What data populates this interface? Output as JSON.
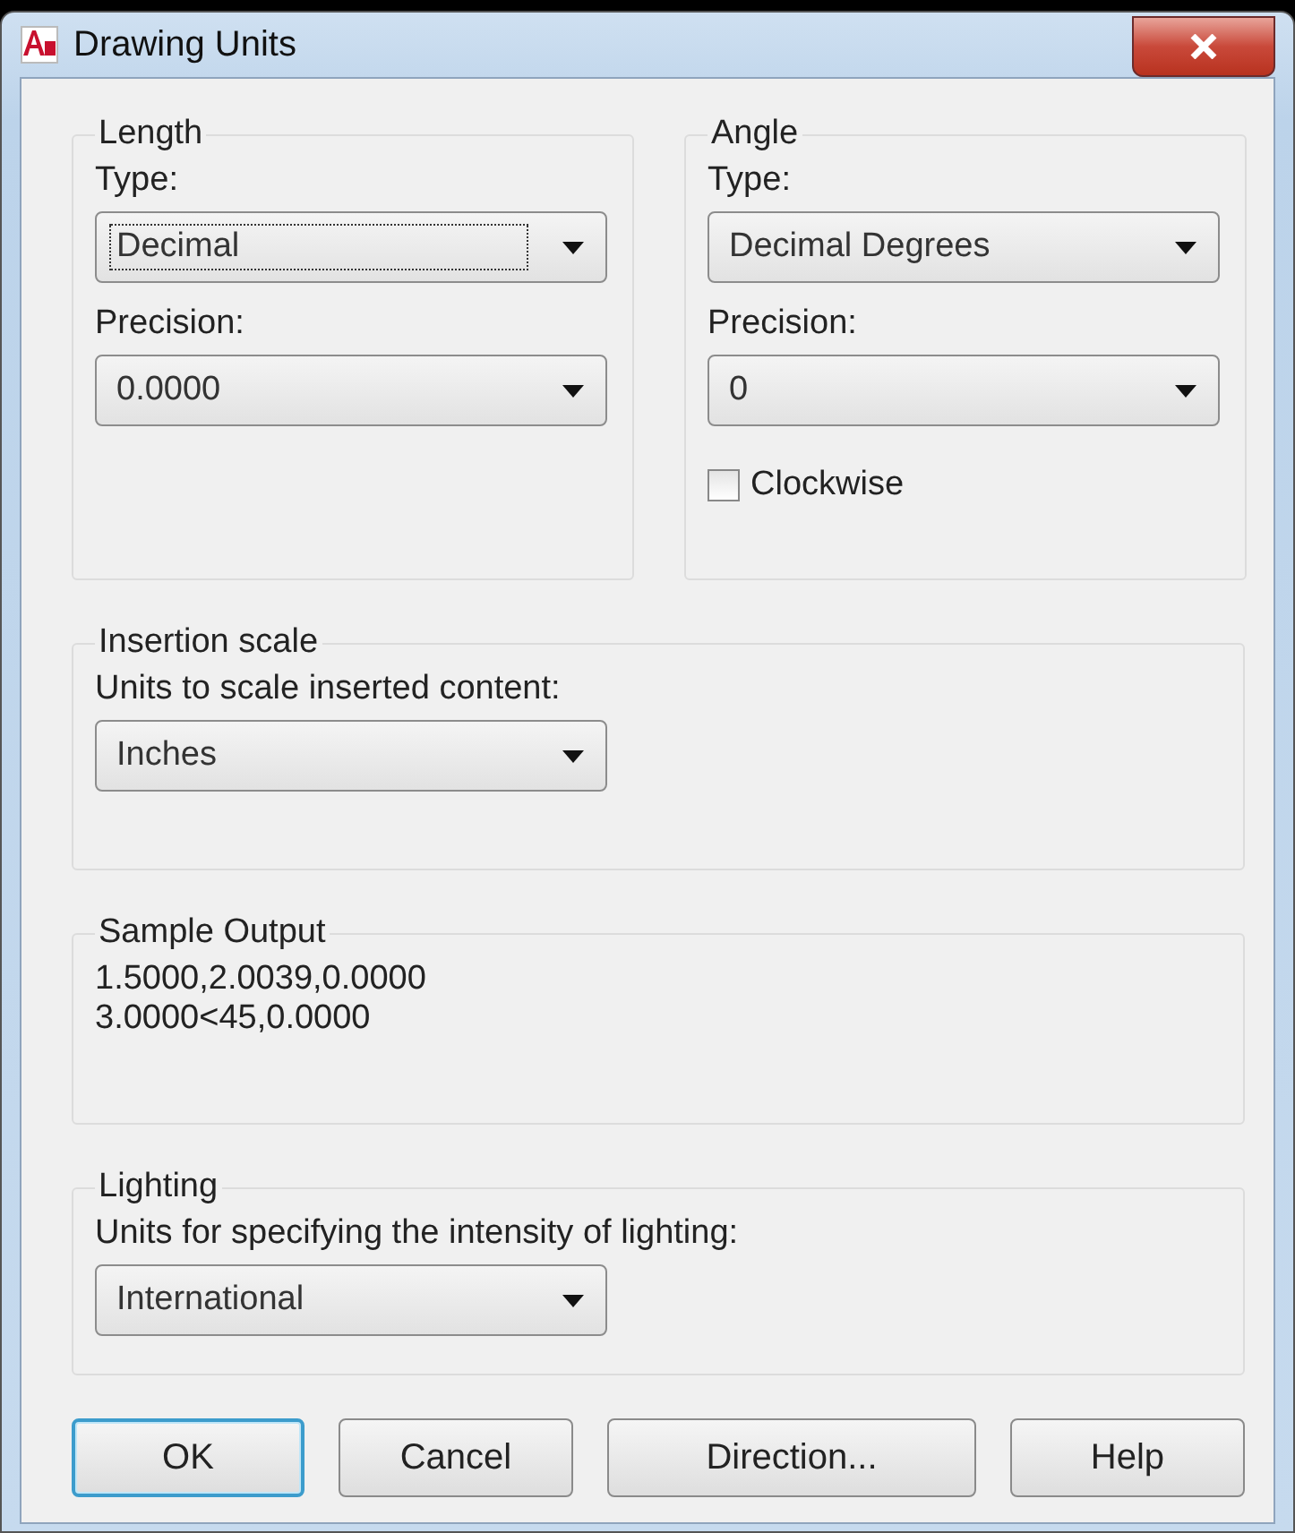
{
  "window": {
    "title": "Drawing Units"
  },
  "length": {
    "title": "Length",
    "type_label": "Type:",
    "type_value": "Decimal",
    "type_focused": true,
    "precision_label": "Precision:",
    "precision_value": "0.0000"
  },
  "angle": {
    "title": "Angle",
    "type_label": "Type:",
    "type_value": "Decimal Degrees",
    "precision_label": "Precision:",
    "precision_value": "0",
    "clockwise": {
      "label": "Clockwise",
      "checked": false
    }
  },
  "insertion_scale": {
    "title": "Insertion scale",
    "label": "Units to scale inserted content:",
    "value": "Inches"
  },
  "sample_output": {
    "title": "Sample Output",
    "lines": [
      "1.5000,2.0039,0.0000",
      "3.0000<45,0.0000"
    ]
  },
  "lighting": {
    "title": "Lighting",
    "label": "Units for specifying the intensity of lighting:",
    "value": "International"
  },
  "buttons": [
    {
      "label": "OK",
      "default": true
    },
    {
      "label": "Cancel",
      "default": false
    },
    {
      "label": "Direction...",
      "default": false
    },
    {
      "label": "Help",
      "default": false
    }
  ]
}
